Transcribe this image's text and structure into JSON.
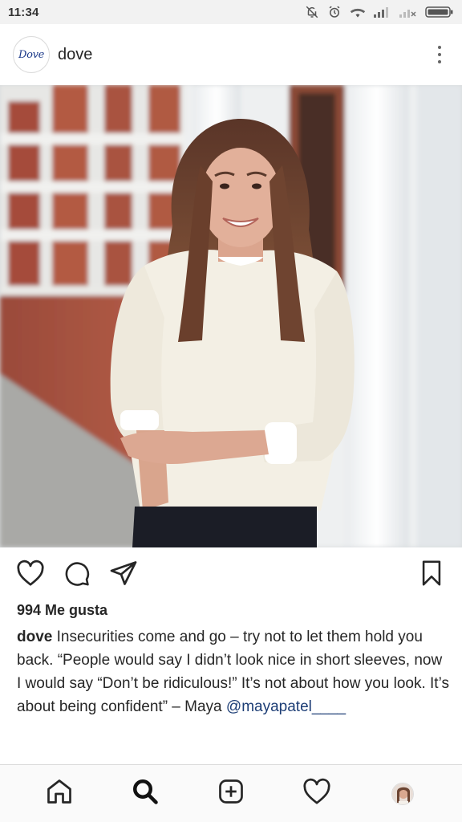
{
  "status_bar": {
    "time": "11:34",
    "icons": [
      "mute-icon",
      "alarm-icon",
      "wifi-icon",
      "signal-icon",
      "no-signal-icon",
      "battery-icon"
    ]
  },
  "post": {
    "account": {
      "username": "dove",
      "logo_text": "Dove"
    },
    "photo": {
      "subject": "woman-in-cream-sweatshirt"
    },
    "actions": [
      "heart-icon",
      "comment-icon",
      "share-icon",
      "bookmark-icon"
    ],
    "likes": "994 Me gusta",
    "caption": {
      "username": "dove",
      "text": " Insecurities come and go – try not to let them hold you back. “People would say I didn’t look nice in short sleeves, now I would say “Don’t be ridiculous!” It’s not about how you look. It’s about being confident” – Maya ",
      "mention": "@mayapatel____"
    }
  },
  "bottom_nav": {
    "items": [
      "home-icon",
      "search-icon",
      "new-post-icon",
      "activity-heart-icon",
      "profile-avatar"
    ],
    "active": "search-icon"
  },
  "colors": {
    "text": "#262626",
    "mention": "#1c3d75",
    "status_bar_bg": "#f2f2f2",
    "nav_bg": "#fafafa"
  }
}
